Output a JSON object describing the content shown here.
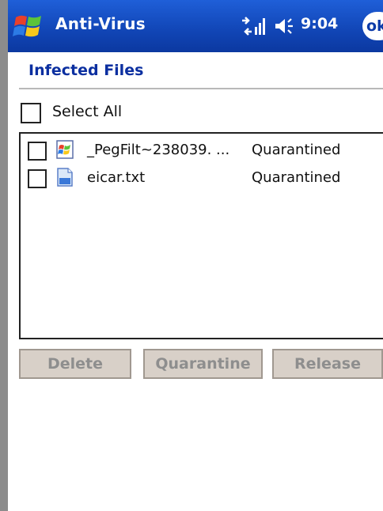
{
  "titlebar": {
    "app_title": "Anti-Virus",
    "clock": "9:04",
    "ok_label": "ok",
    "start_icon": "windows-flag-icon",
    "connectivity_icon": "connectivity-icon",
    "volume_icon": "speaker-icon"
  },
  "header": {
    "title": "Infected Files"
  },
  "select_all": {
    "label": "Select All",
    "checked": false
  },
  "files": [
    {
      "name": "_PegFilt~238039. ...",
      "status": "Quarantined",
      "icon": "executable-file-icon",
      "checked": false
    },
    {
      "name": "eicar.txt",
      "status": "Quarantined",
      "icon": "document-file-icon",
      "checked": false
    }
  ],
  "buttons": {
    "delete": "Delete",
    "quarantine": "Quarantine",
    "release": "Release"
  },
  "colors": {
    "titlebar": "#1247b8",
    "header_text": "#0b2fa0",
    "button_face": "#d8d0c8",
    "button_text_disabled": "#8e8e8e"
  }
}
